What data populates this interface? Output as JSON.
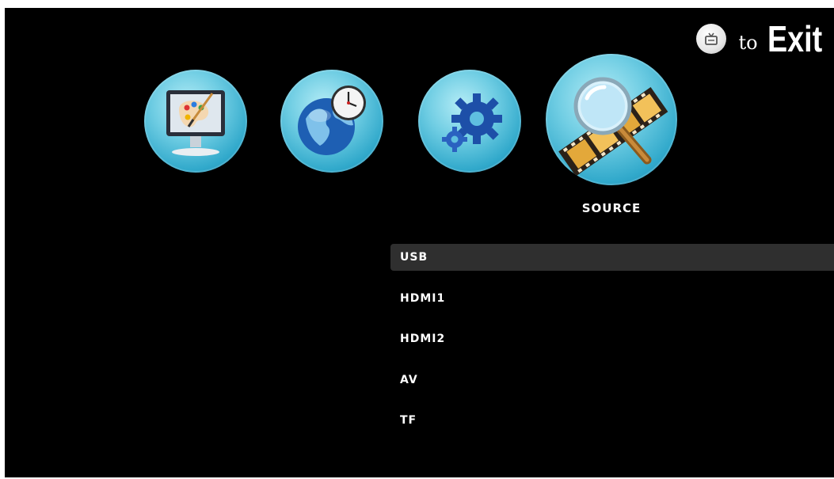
{
  "exit_hint": {
    "icon": "tv-icon",
    "to_text": "to",
    "exit_text": "Exit"
  },
  "menu": {
    "icons": [
      {
        "id": "picture",
        "icon": "monitor-palette-icon"
      },
      {
        "id": "time",
        "icon": "globe-clock-icon"
      },
      {
        "id": "setup",
        "icon": "gears-icon"
      },
      {
        "id": "source",
        "icon": "magnifier-film-icon"
      }
    ],
    "selected_label": "SOURCE"
  },
  "source_list": {
    "items": [
      "USB",
      "HDMI1",
      "HDMI2",
      "AV",
      "TF"
    ],
    "selected_index": 0
  },
  "colors": {
    "background": "#000000",
    "icon_blue": "#31a9cb",
    "selection_bar": "#2f2f2f",
    "text": "#ffffff"
  }
}
